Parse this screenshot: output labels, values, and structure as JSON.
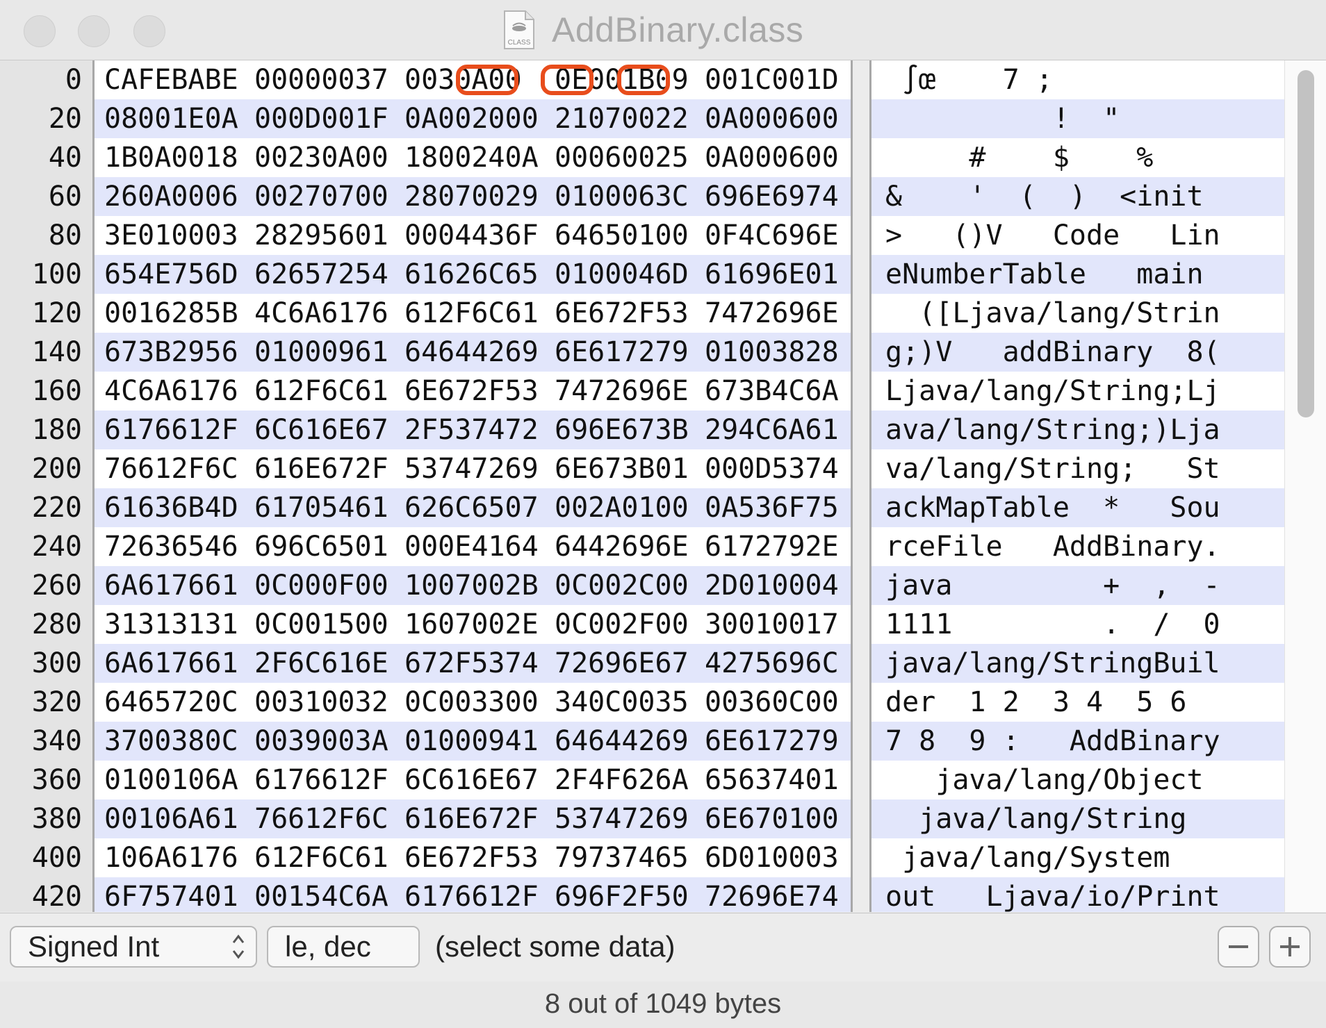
{
  "window": {
    "title": "AddBinary.class",
    "file_icon_label": "CLASS"
  },
  "hex_rows": [
    {
      "offset": "0",
      "words": [
        "CAFEBABE",
        "00000037",
        "0030A00",
        "0E001B09",
        "001C001D"
      ],
      "ascii": " ∫œ    7 ;"
    },
    {
      "offset": "20",
      "words": [
        "08001E0A",
        "000D001F",
        "0A002000",
        "21070022",
        "0A000600"
      ],
      "ascii": "          !  \""
    },
    {
      "offset": "40",
      "words": [
        "1B0A0018",
        "00230A00",
        "1800240A",
        "00060025",
        "0A000600"
      ],
      "ascii": "     #    $    %"
    },
    {
      "offset": "60",
      "words": [
        "260A0006",
        "00270700",
        "28070029",
        "0100063C",
        "696E6974"
      ],
      "ascii": "&    '  (  )  <init"
    },
    {
      "offset": "80",
      "words": [
        "3E010003",
        "28295601",
        "0004436F",
        "64650100",
        "0F4C696E"
      ],
      "ascii": ">   ()V   Code   Lin"
    },
    {
      "offset": "100",
      "words": [
        "654E756D",
        "62657254",
        "61626C65",
        "0100046D",
        "61696E01"
      ],
      "ascii": "eNumberTable   main"
    },
    {
      "offset": "120",
      "words": [
        "0016285B",
        "4C6A6176",
        "612F6C61",
        "6E672F53",
        "7472696E"
      ],
      "ascii": "  ([Ljava/lang/Strin"
    },
    {
      "offset": "140",
      "words": [
        "673B2956",
        "01000961",
        "64644269",
        "6E617279",
        "01003828"
      ],
      "ascii": "g;)V   addBinary  8("
    },
    {
      "offset": "160",
      "words": [
        "4C6A6176",
        "612F6C61",
        "6E672F53",
        "7472696E",
        "673B4C6A"
      ],
      "ascii": "Ljava/lang/String;Lj"
    },
    {
      "offset": "180",
      "words": [
        "6176612F",
        "6C616E67",
        "2F537472",
        "696E673B",
        "294C6A61"
      ],
      "ascii": "ava/lang/String;)Lja"
    },
    {
      "offset": "200",
      "words": [
        "76612F6C",
        "616E672F",
        "53747269",
        "6E673B01",
        "000D5374"
      ],
      "ascii": "va/lang/String;   St"
    },
    {
      "offset": "220",
      "words": [
        "61636B4D",
        "61705461",
        "626C6507",
        "002A0100",
        "0A536F75"
      ],
      "ascii": "ackMapTable  *   Sou"
    },
    {
      "offset": "240",
      "words": [
        "72636546",
        "696C6501",
        "000E4164",
        "6442696E",
        "6172792E"
      ],
      "ascii": "rceFile   AddBinary."
    },
    {
      "offset": "260",
      "words": [
        "6A617661",
        "0C000F00",
        "1007002B",
        "0C002C00",
        "2D010004"
      ],
      "ascii": "java         +  ,  -"
    },
    {
      "offset": "280",
      "words": [
        "31313131",
        "0C001500",
        "1607002E",
        "0C002F00",
        "30010017"
      ],
      "ascii": "1111         .  /  0"
    },
    {
      "offset": "300",
      "words": [
        "6A617661",
        "2F6C616E",
        "672F5374",
        "72696E67",
        "4275696C"
      ],
      "ascii": "java/lang/StringBuil"
    },
    {
      "offset": "320",
      "words": [
        "6465720C",
        "00310032",
        "0C003300",
        "340C0035",
        "00360C00"
      ],
      "ascii": "der  1 2  3 4  5 6"
    },
    {
      "offset": "340",
      "words": [
        "3700380C",
        "0039003A",
        "01000941",
        "64644269",
        "6E617279"
      ],
      "ascii": "7 8  9 :   AddBinary"
    },
    {
      "offset": "360",
      "words": [
        "0100106A",
        "6176612F",
        "6C616E67",
        "2F4F626A",
        "65637401"
      ],
      "ascii": "   java/lang/Object"
    },
    {
      "offset": "380",
      "words": [
        "00106A61",
        "76612F6C",
        "616E672F",
        "53747269",
        "6E670100"
      ],
      "ascii": "  java/lang/String"
    },
    {
      "offset": "400",
      "words": [
        "106A6176",
        "612F6C61",
        "6E672F53",
        "79737465",
        "6D010003"
      ],
      "ascii": " java/lang/System"
    },
    {
      "offset": "420",
      "words": [
        "6F757401",
        "00154C6A",
        "6176612F",
        "696F2F50",
        "72696E74"
      ],
      "ascii": "out   Ljava/io/Print"
    }
  ],
  "controls": {
    "type_select": "Signed Int",
    "endian_select": "le, dec",
    "selection_message": "(select some data)",
    "minus_label": "−",
    "plus_label": "+"
  },
  "status": {
    "text": "8 out of 1049 bytes"
  },
  "colors": {
    "highlight_outline": "#e84d1c",
    "row_stripe": "#e2e6fb"
  }
}
